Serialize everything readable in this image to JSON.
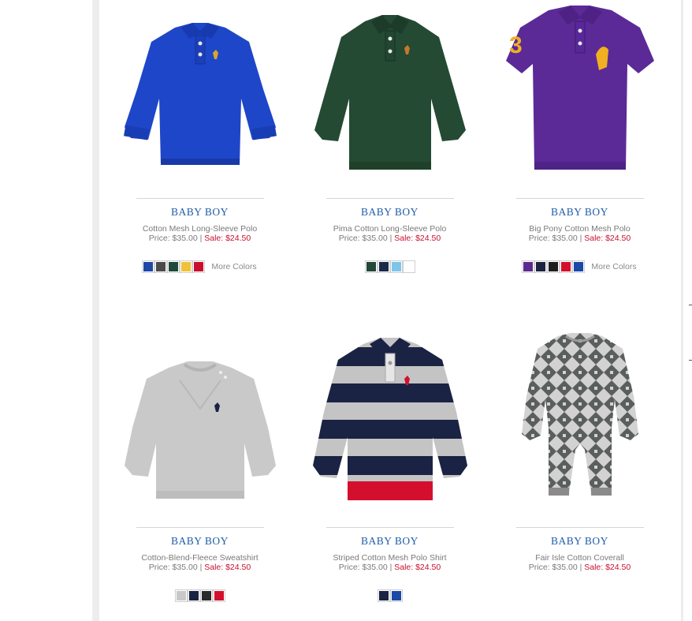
{
  "products": [
    {
      "category": "BABY BOY",
      "name": "Cotton Mesh Long-Sleeve Polo",
      "price": "Price: $35.00",
      "separator": "|",
      "sale": "Sale: $24.50",
      "image_icon": "blue-long-sleeve-polo-image",
      "swatches": [
        "#1f47a7",
        "#4b4b4b",
        "#214a3a",
        "#f1c238",
        "#c8102e"
      ],
      "more_colors": "More Colors"
    },
    {
      "category": "BABY BOY",
      "name": "Pima Cotton Long-Sleeve Polo",
      "price": "Price: $35.00",
      "separator": "|",
      "sale": "Sale: $24.50",
      "image_icon": "green-long-sleeve-polo-image",
      "swatches": [
        "#24473a",
        "#1b2a4a",
        "#7ec5ea",
        "#ffffff"
      ],
      "more_colors": ""
    },
    {
      "category": "BABY BOY",
      "name": "Big Pony Cotton Mesh Polo",
      "price": "Price: $35.00",
      "separator": "|",
      "sale": "Sale: $24.50",
      "image_icon": "purple-short-sleeve-polo-image",
      "swatches": [
        "#5c2a8f",
        "#1d2240",
        "#1f1f1f",
        "#d40f2e",
        "#1a49a8"
      ],
      "more_colors": "More Colors"
    },
    {
      "category": "BABY BOY",
      "name": "Cotton-Blend-Fleece Sweatshirt",
      "price": "Price: $35.00",
      "separator": "|",
      "sale": "Sale: $24.50",
      "image_icon": "grey-sweatshirt-image",
      "swatches": [
        "#c8c8c8",
        "#1b2344",
        "#2a2a2a",
        "#d40f2e"
      ],
      "more_colors": ""
    },
    {
      "category": "BABY BOY",
      "name": "Striped Cotton Mesh Polo Shirt",
      "price": "Price: $35.00",
      "separator": "|",
      "sale": "Sale: $24.50",
      "image_icon": "striped-polo-image",
      "swatches": [
        "#1b2344",
        "#1a49a8"
      ],
      "more_colors": ""
    },
    {
      "category": "BABY BOY",
      "name": "Fair Isle Cotton Coverall",
      "price": "Price: $35.00",
      "separator": "|",
      "sale": "Sale: $24.50",
      "image_icon": "fair-isle-coverall-image",
      "swatches": [],
      "more_colors": ""
    }
  ]
}
